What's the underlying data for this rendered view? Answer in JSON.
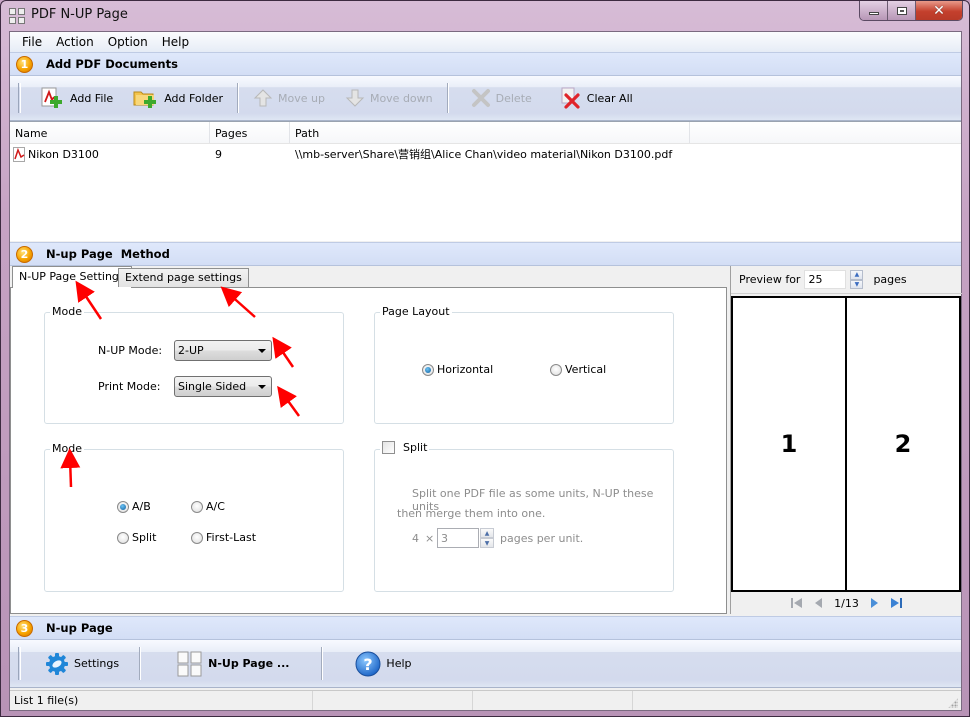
{
  "window": {
    "title": "PDF N-UP Page",
    "controls": {
      "minimize": "minimize",
      "maximize": "maximize",
      "close": "close"
    }
  },
  "menu": [
    "File",
    "Action",
    "Option",
    "Help"
  ],
  "section1": {
    "number": "1",
    "title": "Add PDF Documents",
    "toolbar": [
      {
        "label": "Add File",
        "icon": "add-pdf-file-icon",
        "enabled": true
      },
      {
        "label": "Add Folder",
        "icon": "add-folder-icon",
        "enabled": true
      },
      {
        "label": "Move up",
        "icon": "arrow-up-icon",
        "enabled": false
      },
      {
        "label": "Move down",
        "icon": "arrow-down-icon",
        "enabled": false
      },
      {
        "label": "Delete",
        "icon": "delete-x-icon",
        "enabled": false
      },
      {
        "label": "Clear All",
        "icon": "clear-all-icon",
        "enabled": true
      }
    ],
    "file_list": {
      "columns": [
        "Name",
        "Pages",
        "Path"
      ],
      "rows": [
        {
          "name": "Nikon D3100",
          "pages": "9",
          "path": "\\\\mb-server\\Share\\营销组\\Alice Chan\\video material\\Nikon D3100.pdf"
        }
      ]
    }
  },
  "section2": {
    "number": "2",
    "title": "N-up Page  Method",
    "tabs": [
      {
        "label": "N-UP Page Settings",
        "active": true
      },
      {
        "label": "Extend page settings",
        "active": false
      }
    ],
    "mode_group": {
      "label": "Mode",
      "nup_mode_label": "N-UP Mode:",
      "nup_mode_value": "2-UP",
      "print_mode_label": "Print Mode:",
      "print_mode_value": "Single Sided"
    },
    "page_layout": {
      "label": "Page Layout",
      "options": [
        {
          "label": "Horizontal",
          "selected": true
        },
        {
          "label": "Vertical",
          "selected": false
        }
      ]
    },
    "mode2_group": {
      "label": "Mode",
      "options": [
        {
          "label": "A/B",
          "selected": true
        },
        {
          "label": "A/C",
          "selected": false
        },
        {
          "label": "Split",
          "selected": false
        },
        {
          "label": "First-Last",
          "selected": false
        }
      ]
    },
    "split_group": {
      "label": "Split",
      "checked": false,
      "description_line1": "Split one PDF file as some units, N-UP these units",
      "description_line2": "then merge them into one.",
      "multiplier": "4",
      "times": "×",
      "unit_value": "3",
      "unit_suffix": "pages per unit."
    },
    "preview": {
      "prefix": "Preview for",
      "count": "25",
      "suffix": "pages",
      "pages": [
        "1",
        "2"
      ],
      "page_indicator": "1/13"
    }
  },
  "section3": {
    "number": "3",
    "title": "N-up Page",
    "toolbar": [
      {
        "label": "Settings",
        "icon": "gear-icon"
      },
      {
        "label": "N-Up Page ...",
        "icon": "nup-pages-icon"
      },
      {
        "label": "Help",
        "icon": "help-icon"
      }
    ]
  },
  "status": {
    "text": "List 1 file(s)"
  },
  "colors": {
    "accent_badge": "#f7a400",
    "section_bg": "#d3def5",
    "annotation_arrow": "#ff0000"
  }
}
